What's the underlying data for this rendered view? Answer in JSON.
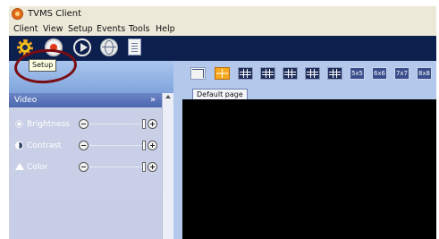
{
  "window": {
    "title": "TVMS Client"
  },
  "menu": [
    "Client",
    "View",
    "Setup",
    "Events",
    "Tools",
    "Help"
  ],
  "toolbar": {
    "tooltip": "Setup",
    "icons": [
      "setup-gear-icon",
      "record-icon",
      "play-icon",
      "globe-icon",
      "document-icon"
    ]
  },
  "video_panel": {
    "title": "Video",
    "controls": [
      {
        "label": "Brightness",
        "icon": "brightness-icon",
        "value": 1.0
      },
      {
        "label": "Contrast",
        "icon": "contrast-icon",
        "value": 1.0
      },
      {
        "label": "Color",
        "icon": "color-icon",
        "value": 1.0
      }
    ]
  },
  "layouts": {
    "grids": [
      "1x1",
      "2x2",
      "3x3",
      "4x4",
      "1+5",
      "1+7",
      "1+12"
    ],
    "numbered": [
      "5x5",
      "6x6",
      "7x7",
      "8x8"
    ],
    "active": "2x2"
  },
  "tabs": [
    {
      "label": "Default page"
    }
  ],
  "colors": {
    "accent": "#f7a81c",
    "annotation": "#7a0c12",
    "panel": "#c7cee6",
    "toolbar": "#0c1f4d"
  }
}
